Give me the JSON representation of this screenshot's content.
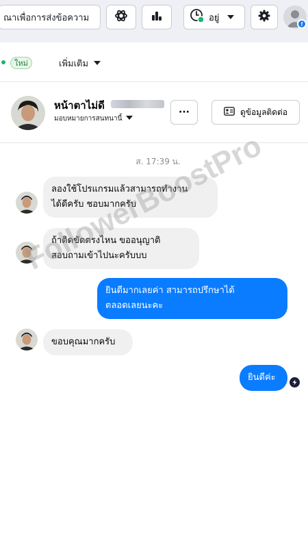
{
  "toolbar": {
    "search_text": "ณาเพื่อการส่งข้อความ",
    "status_label": "อยู่"
  },
  "tabs": {
    "new_badge": "ใหม่",
    "more_label": "เพิ่มเติม"
  },
  "header": {
    "name": "หน้าตาไม่ดี",
    "assign_label": "มอบหมายการสนทนานี้",
    "more_button": "···",
    "contact_button": "ดูข้อมูลติดต่อ"
  },
  "conversation": {
    "timestamp": "ส. 17:39 น.",
    "messages": [
      {
        "direction": "in",
        "lines": [
          "ลองใช้โปรแกรมแล้วสามารถทำงาน",
          "ได้ดีครับ ชอบมากครับ"
        ]
      },
      {
        "direction": "in",
        "lines": [
          "ถ้าติดขัดตรงไหน ขออนุญาติ",
          "สอบถามเข้าไปนะครับบบ"
        ]
      },
      {
        "direction": "out",
        "lines": [
          "ยินดีมากเลยค่า สามารถปรึกษาได้",
          "ตลอดเลยนะคะ"
        ]
      },
      {
        "direction": "in",
        "lines": [
          "ขอบคุณมากครับ"
        ]
      },
      {
        "direction": "out",
        "lines": [
          "ยินดีค่ะ"
        ]
      }
    ]
  },
  "watermark": "FollowerBoostPro",
  "colors": {
    "outgoing_bubble": "#0a7cff",
    "incoming_bubble": "#f0f0f0",
    "toolbar_bg": "#eef0f6",
    "online_dot": "#1bb76e",
    "brand_blue": "#1877f2"
  },
  "icons": {
    "toolbar": [
      "meta-ai-icon",
      "bar-chart-icon",
      "clock-status-icon",
      "caret-down-icon",
      "gear-icon"
    ],
    "header": [
      "contact-card-icon"
    ]
  }
}
